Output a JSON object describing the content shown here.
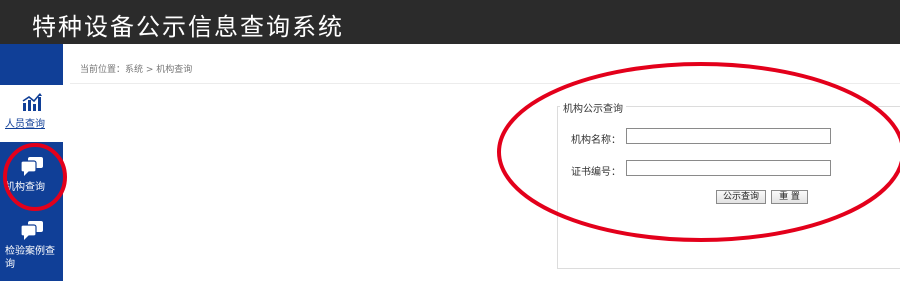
{
  "header": {
    "title": "特种设备公示信息查询系统"
  },
  "sidebar": {
    "items": [
      {
        "label": "人员查询",
        "icon": "bar-chart-icon"
      },
      {
        "label": "机构查询",
        "icon": "chat-bubbles-icon"
      },
      {
        "label": "检验案例查询",
        "icon": "chat-bubbles-icon"
      }
    ]
  },
  "breadcrumb": {
    "text": "当前位置：系统 > 机构查询"
  },
  "form": {
    "legend": "机构公示查询",
    "name_label": "机构名称：",
    "name_value": "",
    "cert_label": "证书编号：",
    "cert_value": "",
    "search_button": "公示查询",
    "reset_button": "重 置"
  },
  "colors": {
    "header_bg": "#2b2b2b",
    "sidebar_bg": "#103f97",
    "annotation_red": "#e3001b"
  }
}
